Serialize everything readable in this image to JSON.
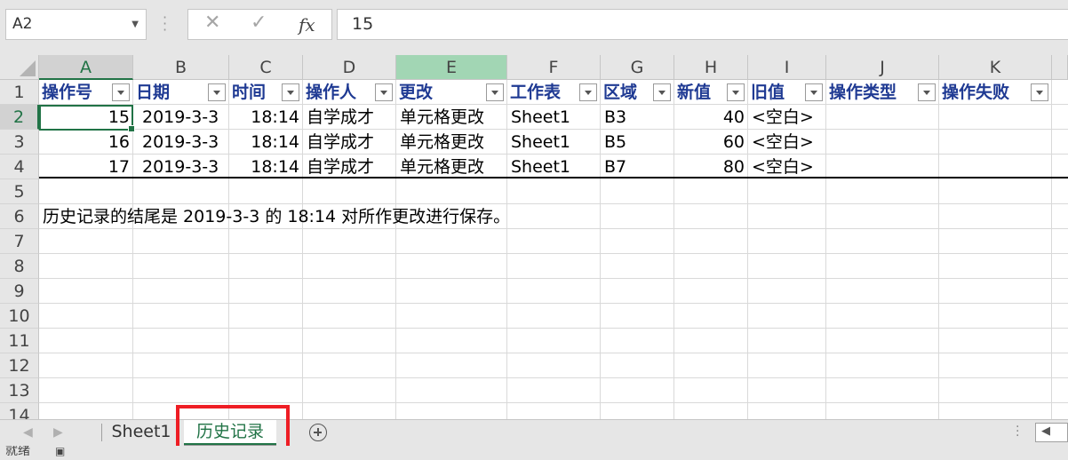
{
  "formula_bar": {
    "name_box": "A2",
    "cancel_glyph": "✕",
    "enter_glyph": "✓",
    "fx_label": "fx",
    "formula_value": "15"
  },
  "columns": [
    "A",
    "B",
    "C",
    "D",
    "E",
    "F",
    "G",
    "H",
    "I",
    "J",
    "K"
  ],
  "rows": [
    "1",
    "2",
    "3",
    "4",
    "5",
    "6",
    "7",
    "8",
    "9",
    "10",
    "11",
    "12",
    "13",
    "14"
  ],
  "header_row": [
    "操作号",
    "日期",
    "时间",
    "操作人",
    "更改",
    "工作表",
    "区域",
    "新值",
    "旧值",
    "操作类型",
    "操作失败"
  ],
  "data_rows": [
    {
      "id": "15",
      "date": "2019-3-3",
      "time": "18:14",
      "user": "自学成才",
      "change": "单元格更改",
      "sheet": "Sheet1",
      "range": "B3",
      "new": "40",
      "old": "<空白>"
    },
    {
      "id": "16",
      "date": "2019-3-3",
      "time": "18:14",
      "user": "自学成才",
      "change": "单元格更改",
      "sheet": "Sheet1",
      "range": "B5",
      "new": "60",
      "old": "<空白>"
    },
    {
      "id": "17",
      "date": "2019-3-3",
      "time": "18:14",
      "user": "自学成才",
      "change": "单元格更改",
      "sheet": "Sheet1",
      "range": "B7",
      "new": "80",
      "old": "<空白>"
    }
  ],
  "note": "历史记录的结尾是 2019-3-3 的 18:14 对所作更改进行保存。",
  "tabs": {
    "sheet1": "Sheet1",
    "history": "历史记录"
  },
  "status": {
    "text": "就绪"
  },
  "colors": {
    "accent": "#217346",
    "highlight": "#ee1d24",
    "header_text": "#1f3a93"
  }
}
